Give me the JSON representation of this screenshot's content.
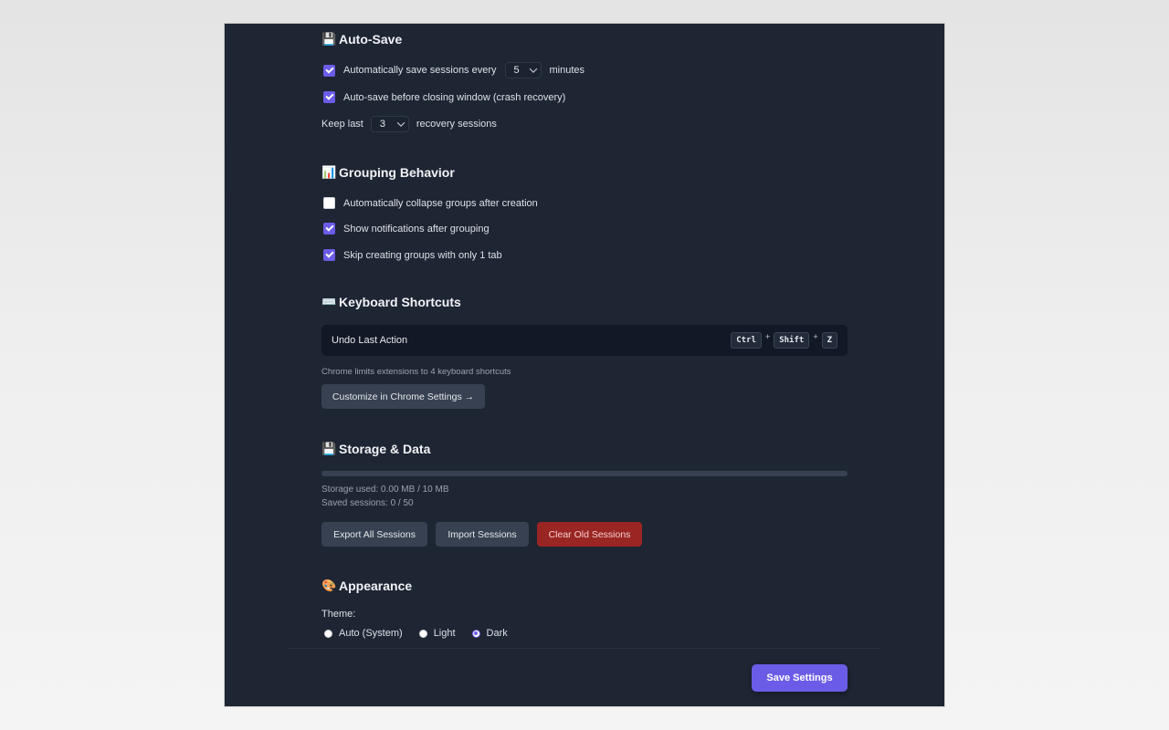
{
  "colors": {
    "accent": "#6b5ce7",
    "panel_bg": "#1e2533",
    "danger": "#992623"
  },
  "auto_save": {
    "icon": "floppy-disk-icon",
    "title": "Auto-Save",
    "interval_prefix": "Automatically save sessions every",
    "interval_value": "5",
    "interval_suffix": "minutes",
    "interval_checked": true,
    "before_close_label": "Auto-save before closing window (crash recovery)",
    "before_close_checked": true,
    "keep_prefix": "Keep last",
    "keep_value": "3",
    "keep_suffix": "recovery sessions"
  },
  "grouping": {
    "icon": "bar-chart-icon",
    "title": "Grouping Behavior",
    "collapse_label": "Automatically collapse groups after creation",
    "collapse_checked": false,
    "notify_label": "Show notifications after grouping",
    "notify_checked": true,
    "skip_label": "Skip creating groups with only 1 tab",
    "skip_checked": true
  },
  "shortcuts": {
    "icon": "keyboard-icon",
    "title": "Keyboard Shortcuts",
    "undo_label": "Undo Last Action",
    "keys": [
      "Ctrl",
      "Shift",
      "Z"
    ],
    "plus": "+",
    "hint": "Chrome limits extensions to 4 keyboard shortcuts",
    "customize_button": "Customize in Chrome Settings →"
  },
  "storage": {
    "icon": "floppy-disk-icon",
    "title": "Storage & Data",
    "usage_fraction": 0,
    "storage_used": "Storage used: 0.00 MB / 10 MB",
    "saved_sessions": "Saved sessions: 0 / 50",
    "export_button": "Export All Sessions",
    "import_button": "Import Sessions",
    "clear_button": "Clear Old Sessions"
  },
  "appearance": {
    "icon": "palette-icon",
    "title": "Appearance",
    "theme_label": "Theme:",
    "options": [
      "Auto (System)",
      "Light",
      "Dark"
    ],
    "selected": "Dark"
  },
  "footer": {
    "save_button": "Save Settings"
  }
}
